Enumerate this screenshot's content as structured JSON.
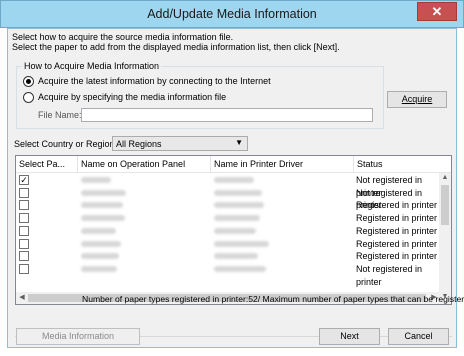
{
  "window": {
    "title": "Add/Update Media Information",
    "close_glyph": "✕"
  },
  "instructions": {
    "line1": "Select how to acquire the source media information file.",
    "line2": "Select the paper to add from the displayed media information list, then click [Next]."
  },
  "acquire_group": {
    "legend": "How to Acquire Media Information",
    "option_internet": "Acquire the latest information by connecting to the Internet",
    "option_file": "Acquire by specifying the media information file",
    "file_name_label": "File Name:",
    "file_name_value": "",
    "selected": "internet"
  },
  "acquire_button": "Acquire",
  "region": {
    "label": "Select Country or Region",
    "value": "All Regions"
  },
  "media_list": {
    "columns": [
      "Select Pa...",
      "Name on Operation Panel",
      "Name in Printer Driver",
      "Status"
    ],
    "rows": [
      {
        "checked": true,
        "status": "Not registered in printer"
      },
      {
        "checked": false,
        "status": "Not registered in printer"
      },
      {
        "checked": false,
        "status": "Registered in printer"
      },
      {
        "checked": false,
        "status": "Registered in printer"
      },
      {
        "checked": false,
        "status": "Registered in printer"
      },
      {
        "checked": false,
        "status": "Registered in printer"
      },
      {
        "checked": false,
        "status": "Registered in printer"
      },
      {
        "checked": false,
        "status": "Not registered in printer"
      }
    ]
  },
  "footer": {
    "count_text": "Number of paper types registered in printer:52/ Maximum number of paper types that can be registered:65",
    "media_info_button": "Media Information",
    "next_button": "Next",
    "cancel_button": "Cancel"
  }
}
